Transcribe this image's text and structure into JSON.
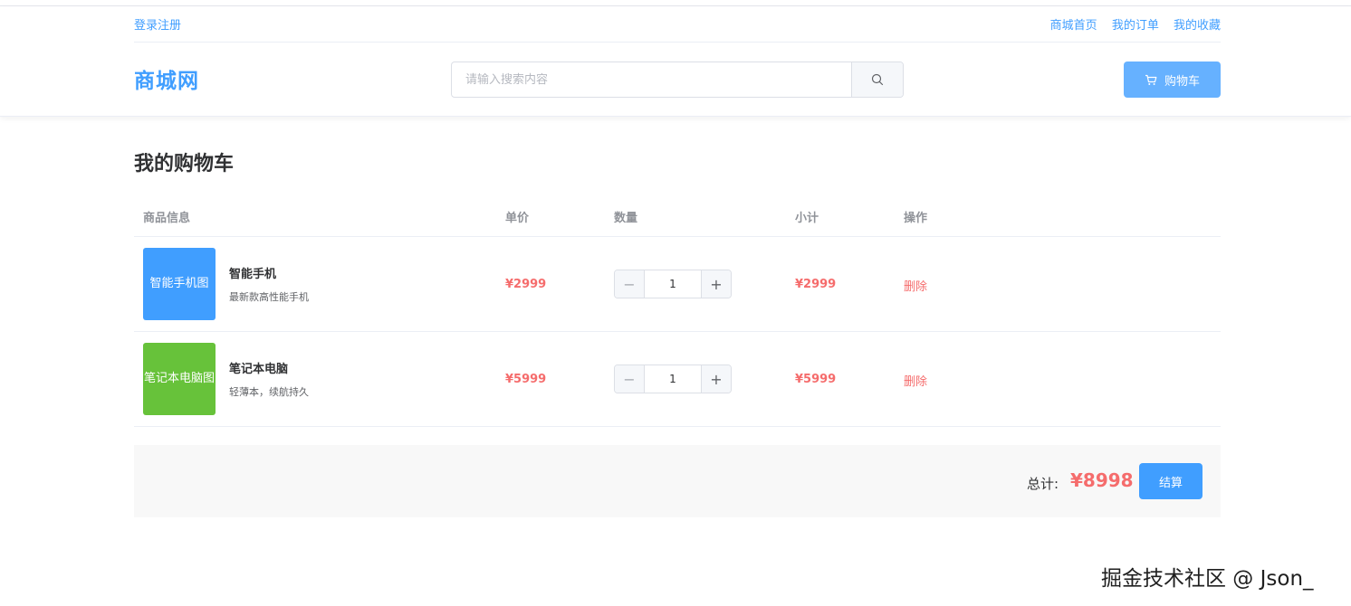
{
  "topbar": {
    "login": "登录注册",
    "links": [
      "商城首页",
      "我的订单",
      "我的收藏"
    ]
  },
  "brand": {
    "logo": "商城网",
    "search_placeholder": "请输入搜索内容",
    "cart_label": "购物车"
  },
  "cart": {
    "title": "我的购物车",
    "columns": {
      "product": "商品信息",
      "unit_price": "单价",
      "quantity": "数量",
      "subtotal": "小计",
      "action": "操作"
    },
    "items": [
      {
        "thumb_text": "智能手机图",
        "thumb_color": "#409eff",
        "name": "智能手机",
        "desc": "最新款高性能手机",
        "price": "¥2999",
        "qty": "1",
        "subtotal": "¥2999",
        "delete": "删除"
      },
      {
        "thumb_text": "笔记本电脑图",
        "thumb_color": "#67c23a",
        "name": "笔记本电脑",
        "desc": "轻薄本，续航持久",
        "price": "¥5999",
        "qty": "1",
        "subtotal": "¥5999",
        "delete": "删除"
      }
    ],
    "total_label": "总计:",
    "total_value": "¥8998",
    "checkout": "结算"
  },
  "watermark": "掘金技术社区 @ Json_",
  "colors": {
    "primary": "#409eff",
    "danger": "#f56c6c"
  }
}
